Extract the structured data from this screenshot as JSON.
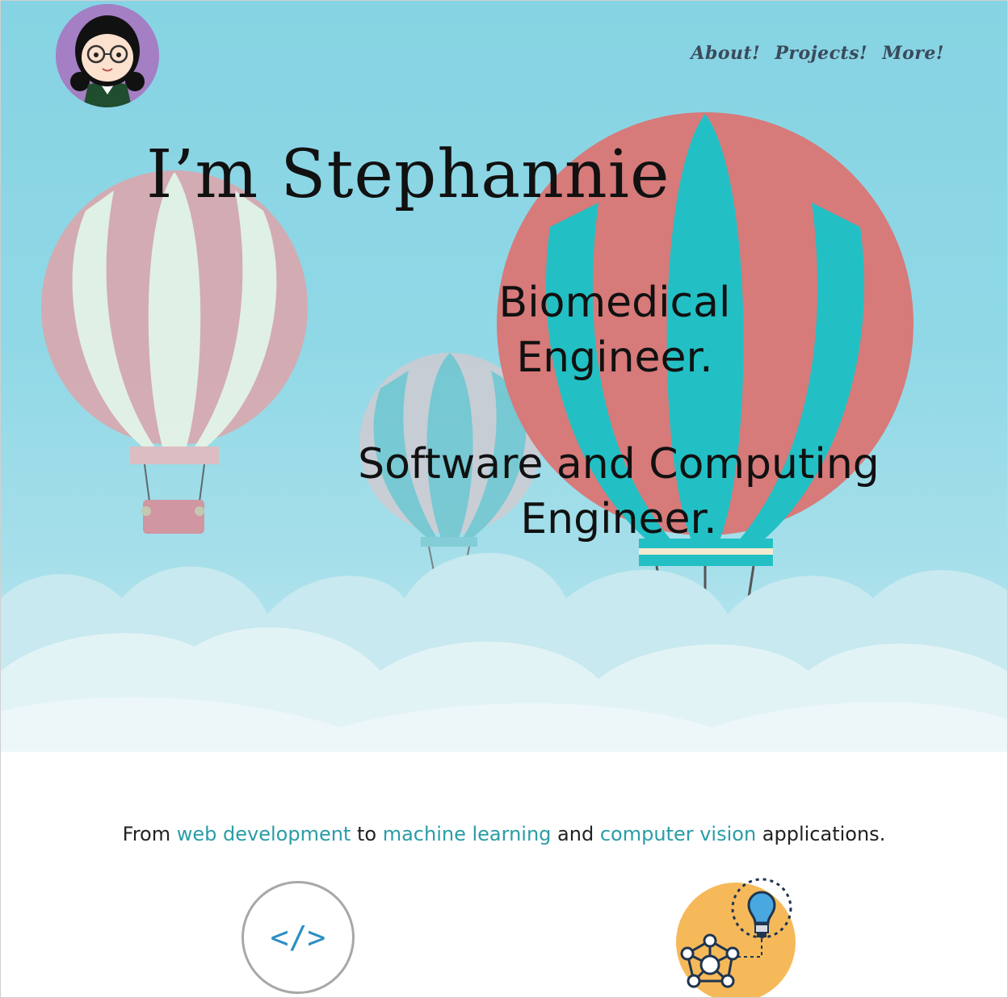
{
  "header": {
    "avatar_icon": "girl-with-glasses-avatar",
    "nav": [
      {
        "label": "About!"
      },
      {
        "label": "Projects!"
      },
      {
        "label": "More!"
      }
    ]
  },
  "hero": {
    "title": "I’m Stephannie",
    "subtitle_1_line_1": "Biomedical",
    "subtitle_1_line_2": "Engineer.",
    "subtitle_2_line_1": "Software and Computing",
    "subtitle_2_line_2": "Engineer."
  },
  "intro": {
    "prefix": "From",
    "link_1": "web development",
    "joiner_1": "to",
    "link_2": "machine learning",
    "joiner_2": "and",
    "link_3": "computer vision",
    "suffix": "applications."
  },
  "skills": {
    "code_icon_text": "</>",
    "code_icon": "code-brackets-icon",
    "ml_icon": "network-lightbulb-icon"
  },
  "colors": {
    "sky": "#8fd6e5",
    "link": "#2a9da6",
    "balloon_red": "#d77a7a",
    "balloon_teal": "#22c0c4",
    "avatar_bg": "#a47fc4",
    "ml_circle": "#f6b95a"
  }
}
